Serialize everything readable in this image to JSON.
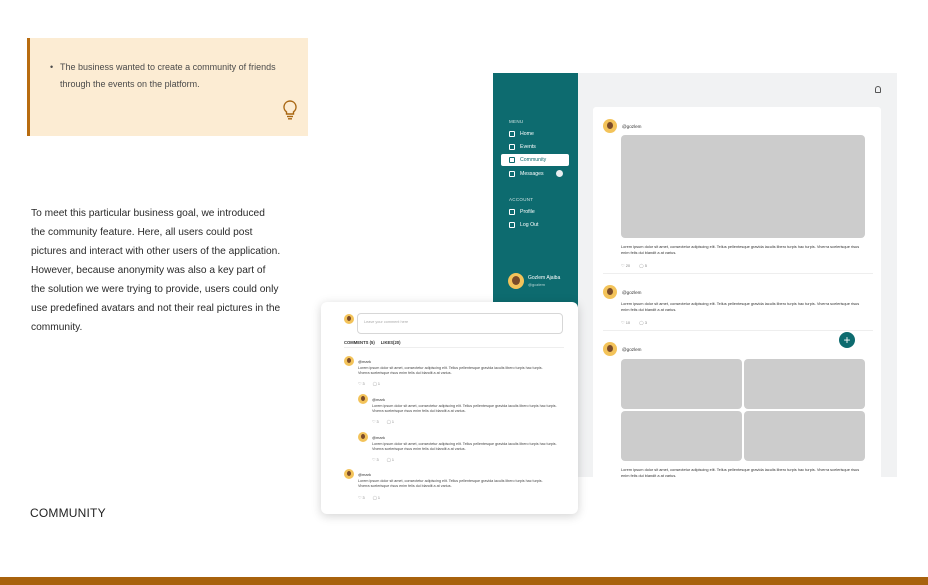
{
  "note": {
    "bullet": "The business wanted to create a community of friends through the events on the platform."
  },
  "body_text": "To meet this particular business goal, we introduced the community feature. Here, all users could post pictures and interact with other users of the application. However, because anonymity was also a key part of the solution we were trying to provide, users could only use predefined avatars  and not their real pictures in the community.",
  "section_title": "COMMUNITY",
  "app": {
    "sidebar": {
      "menu_heading": "MENU",
      "menu_items": [
        {
          "label": "Home",
          "icon": "home-icon"
        },
        {
          "label": "Events",
          "icon": "gift-icon"
        },
        {
          "label": "Community",
          "icon": "users-icon",
          "active": true
        },
        {
          "label": "Messages",
          "icon": "mail-icon"
        }
      ],
      "account_heading": "ACCOUNT",
      "account_items": [
        {
          "label": "Profile",
          "icon": "user-icon"
        },
        {
          "label": "Log Out",
          "icon": "logout-icon"
        }
      ],
      "user": {
        "name": "Gozlem Ajaiba",
        "handle": "@gozlem"
      }
    },
    "posts": [
      {
        "handle": "@gozlem",
        "text": "Lorem ipsum dolor sit amet, consectetur adipiscing elit. Tellus pellentesque gravida iaculis libero turpis hac turpis. Viverra scelerisque risus enim felis dui blandit a at varius.",
        "likes": "20",
        "comments": "5"
      },
      {
        "handle": "@gozlem",
        "text": "Lorem ipsum dolor sit amet, consectetur adipiscing elit. Tellus pellentesque gravida iaculis libero turpis hac turpis. Viverra scelerisque risus enim felis dui blandit a at varius.",
        "likes": "10",
        "comments": "3"
      },
      {
        "handle": "@gozlem",
        "text": "Lorem ipsum dolor sit amet, consectetur adipiscing elit. Tellus pellentesque gravida iaculis libero turpis hac turpis. Viverra scelerisque risus enim felis dui blandit a at varius."
      }
    ]
  },
  "comments_card": {
    "input_placeholder": "Leave your comment here",
    "tabs": [
      "COMMENTS (5)",
      "LIKES(20)"
    ],
    "comments": [
      {
        "handle": "@mark",
        "text": "Lorem ipsum dolor sit amet, consectetur adipiscing elit. Tellus pellentesque gravida iaculis libero turpis hac turpis. Viverra scelerisque risus enim felis dui blandit a at varius.",
        "likes": "3",
        "replies": "1"
      },
      {
        "handle": "@mark",
        "text": "Lorem ipsum dolor sit amet, consectetur adipiscing elit. Tellus pellentesque gravida iaculis libero turpis hac turpis. Viverra scelerisque risus enim felis dui blandit a at varius.",
        "likes": "3",
        "replies": "1"
      },
      {
        "handle": "@mark",
        "text": "Lorem ipsum dolor sit amet, consectetur adipiscing elit. Tellus pellentesque gravida iaculis libero turpis hac turpis. Viverra scelerisque risus enim felis dui blandit a at varius.",
        "likes": "3",
        "replies": "1"
      },
      {
        "handle": "@mark",
        "text": "Lorem ipsum dolor sit amet, consectetur adipiscing elit. Tellus pellentesque gravida iaculis libero turpis hac turpis. Viverra scelerisque risus enim felis dui blandit a at varius.",
        "likes": "3",
        "replies": "1"
      }
    ]
  },
  "colors": {
    "accent": "#0d6b6f",
    "note_bg": "#fcecd3",
    "brand_brown": "#a8620d"
  }
}
